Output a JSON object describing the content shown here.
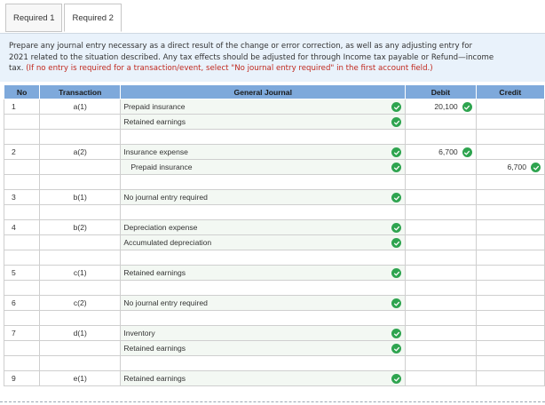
{
  "tabs": [
    {
      "label": "Required 1",
      "active": false
    },
    {
      "label": "Required 2",
      "active": true
    }
  ],
  "instructions": {
    "line1": "Prepare any journal entry necessary as a direct result of the change or error correction, as well as any adjusting entry for",
    "line2": "2021 related to the situation described. Any tax effects should be adjusted for through Income tax payable or Refund—income",
    "line3_prefix": "tax.",
    "line3_note": "(If no entry is required for a transaction/event, select \"No journal entry required\" in the first account field.)"
  },
  "table": {
    "headers": [
      "No",
      "Transaction",
      "General Journal",
      "Debit",
      "Credit"
    ],
    "rows": [
      {
        "no": "1",
        "transaction": "a(1)",
        "account": "Prepaid insurance",
        "debit": "20,100",
        "credit": "",
        "indent": false,
        "spacer": false
      },
      {
        "no": "",
        "transaction": "",
        "account": "Retained earnings",
        "debit": "",
        "credit": "",
        "indent": false,
        "spacer": false
      },
      {
        "no": "",
        "transaction": "",
        "account": "",
        "debit": "",
        "credit": "",
        "indent": false,
        "spacer": true
      },
      {
        "no": "2",
        "transaction": "a(2)",
        "account": "Insurance expense",
        "debit": "6,700",
        "credit": "",
        "indent": false,
        "spacer": false
      },
      {
        "no": "",
        "transaction": "",
        "account": "Prepaid insurance",
        "debit": "",
        "credit": "6,700",
        "indent": true,
        "spacer": false
      },
      {
        "no": "",
        "transaction": "",
        "account": "",
        "debit": "",
        "credit": "",
        "indent": false,
        "spacer": true
      },
      {
        "no": "3",
        "transaction": "b(1)",
        "account": "No journal entry required",
        "debit": "",
        "credit": "",
        "indent": false,
        "spacer": false
      },
      {
        "no": "",
        "transaction": "",
        "account": "",
        "debit": "",
        "credit": "",
        "indent": false,
        "spacer": true
      },
      {
        "no": "4",
        "transaction": "b(2)",
        "account": "Depreciation expense",
        "debit": "",
        "credit": "",
        "indent": false,
        "spacer": false
      },
      {
        "no": "",
        "transaction": "",
        "account": "Accumulated depreciation",
        "debit": "",
        "credit": "",
        "indent": false,
        "spacer": false
      },
      {
        "no": "",
        "transaction": "",
        "account": "",
        "debit": "",
        "credit": "",
        "indent": false,
        "spacer": true
      },
      {
        "no": "5",
        "transaction": "c(1)",
        "account": "Retained earnings",
        "debit": "",
        "credit": "",
        "indent": false,
        "spacer": false
      },
      {
        "no": "",
        "transaction": "",
        "account": "",
        "debit": "",
        "credit": "",
        "indent": false,
        "spacer": true
      },
      {
        "no": "6",
        "transaction": "c(2)",
        "account": "No journal entry required",
        "debit": "",
        "credit": "",
        "indent": false,
        "spacer": false
      },
      {
        "no": "",
        "transaction": "",
        "account": "",
        "debit": "",
        "credit": "",
        "indent": false,
        "spacer": true
      },
      {
        "no": "7",
        "transaction": "d(1)",
        "account": "Inventory",
        "debit": "",
        "credit": "",
        "indent": false,
        "spacer": false
      },
      {
        "no": "",
        "transaction": "",
        "account": "Retained earnings",
        "debit": "",
        "credit": "",
        "indent": false,
        "spacer": false
      },
      {
        "no": "",
        "transaction": "",
        "account": "",
        "debit": "",
        "credit": "",
        "indent": false,
        "spacer": true
      },
      {
        "no": "9",
        "transaction": "e(1)",
        "account": "Retained earnings",
        "debit": "",
        "credit": "",
        "indent": false,
        "spacer": false
      }
    ]
  },
  "colors": {
    "header_bg": "#7ea9db",
    "instructions_bg": "#e9f2fb",
    "note_red": "#c0281e",
    "check_green": "#2ea44f"
  },
  "icons": {
    "correct": "check-circle-icon"
  }
}
